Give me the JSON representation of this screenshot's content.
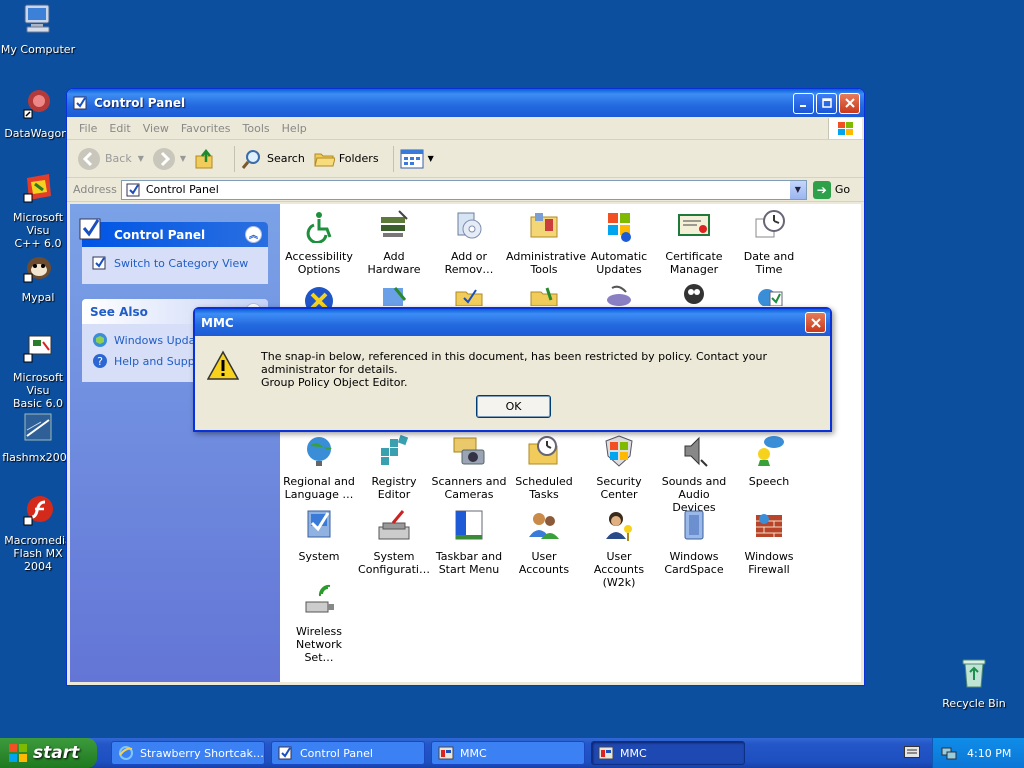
{
  "desktop": {
    "icons": [
      {
        "label": "My Computer",
        "icon": "my-computer-icon"
      },
      {
        "label": "DataWagon.",
        "icon": "datawagon-icon"
      },
      {
        "label": "Microsoft Visu\nC++ 6.0",
        "icon": "visual-cpp-icon"
      },
      {
        "label": "Mypal",
        "icon": "mypal-icon"
      },
      {
        "label": "Microsoft Visu\nBasic 6.0",
        "icon": "visual-basic-icon"
      },
      {
        "label": "flashmx2004",
        "icon": "flashmx-icon"
      },
      {
        "label": "Macromedia\nFlash MX 2004",
        "icon": "macromedia-flash-icon"
      },
      {
        "label": "Recycle Bin",
        "icon": "recycle-bin-icon"
      }
    ]
  },
  "window": {
    "title": "Control Panel",
    "menu": [
      "File",
      "Edit",
      "View",
      "Favorites",
      "Tools",
      "Help"
    ],
    "toolbar": {
      "back": "Back",
      "search": "Search",
      "folders": "Folders"
    },
    "address": {
      "label": "Address",
      "value": "Control Panel",
      "go": "Go"
    },
    "sidepane": {
      "control_panel_header": "Control Panel",
      "switch_view": "Switch to Category View",
      "see_also_header": "See Also",
      "windows_update": "Windows Update",
      "help_support": "Help and Support"
    },
    "items": [
      {
        "label": "Accessibility\nOptions",
        "icon": "accessibility-icon"
      },
      {
        "label": "Add Hardware",
        "icon": "add-hardware-icon"
      },
      {
        "label": "Add or\nRemov…",
        "icon": "add-remove-programs-icon"
      },
      {
        "label": "Administrative\nTools",
        "icon": "administrative-tools-icon"
      },
      {
        "label": "Automatic\nUpdates",
        "icon": "automatic-updates-icon"
      },
      {
        "label": "Certificate\nManager",
        "icon": "certificate-manager-icon"
      },
      {
        "label": "Date and Time",
        "icon": "date-time-icon"
      },
      {
        "label": "Regional and\nLanguage …",
        "icon": "regional-language-icon"
      },
      {
        "label": "Registry Editor",
        "icon": "registry-editor-icon"
      },
      {
        "label": "Scanners and\nCameras",
        "icon": "scanners-cameras-icon"
      },
      {
        "label": "Scheduled\nTasks",
        "icon": "scheduled-tasks-icon"
      },
      {
        "label": "Security\nCenter",
        "icon": "security-center-icon"
      },
      {
        "label": "Sounds and\nAudio Devices",
        "icon": "sounds-audio-icon"
      },
      {
        "label": "Speech",
        "icon": "speech-icon"
      },
      {
        "label": "System",
        "icon": "system-icon"
      },
      {
        "label": "System\nConfigurati…",
        "icon": "system-configuration-icon"
      },
      {
        "label": "Taskbar and\nStart Menu",
        "icon": "taskbar-start-menu-icon"
      },
      {
        "label": "User Accounts",
        "icon": "user-accounts-icon"
      },
      {
        "label": "User Accounts\n(W2k)",
        "icon": "user-accounts-w2k-icon"
      },
      {
        "label": "Windows\nCardSpace",
        "icon": "windows-cardspace-icon"
      },
      {
        "label": "Windows\nFirewall",
        "icon": "windows-firewall-icon"
      },
      {
        "label": "Wireless\nNetwork Set…",
        "icon": "wireless-network-icon"
      }
    ]
  },
  "dialog": {
    "title": "MMC",
    "message_line1": "The snap-in below, referenced in this document, has been restricted by policy. Contact your administrator for details.",
    "message_line2": "Group Policy Object Editor.",
    "ok": "OK"
  },
  "taskbar": {
    "start": "start",
    "buttons": [
      {
        "label": "Strawberry Shortcak…",
        "active": false
      },
      {
        "label": "Control Panel",
        "active": false
      },
      {
        "label": "MMC",
        "active": false
      },
      {
        "label": "MMC",
        "active": true
      }
    ],
    "clock": "4:10 PM"
  }
}
